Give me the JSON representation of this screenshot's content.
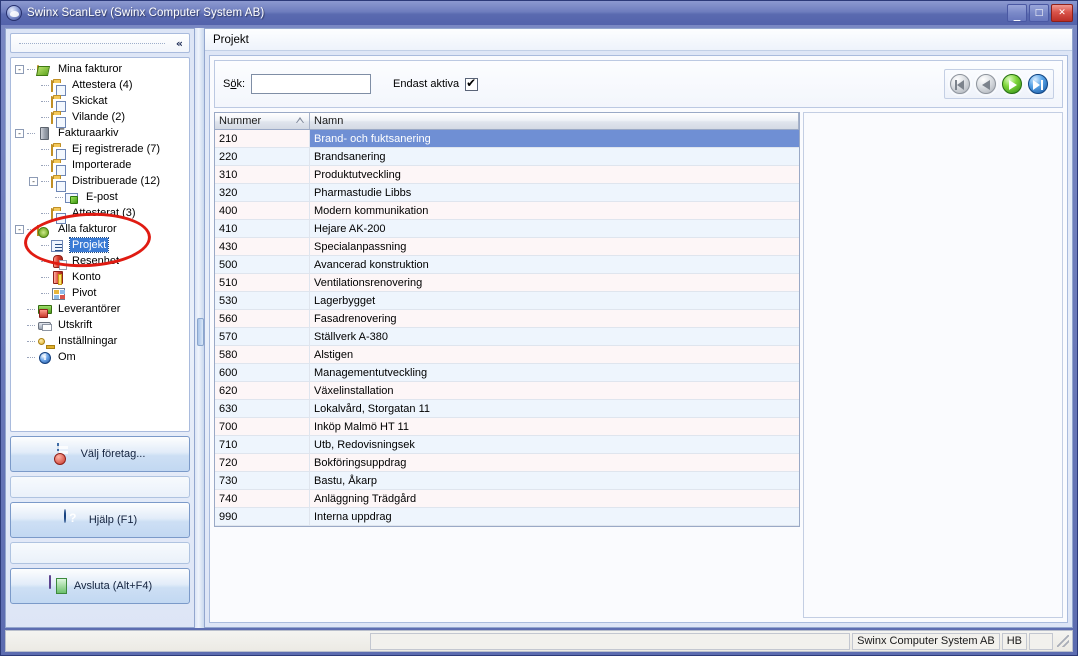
{
  "window": {
    "title": "Swinx ScanLev (Swinx Computer System AB)",
    "minimize_label": "_",
    "maximize_label": "□",
    "close_label": "✕"
  },
  "sidebar": {
    "collapse_label": "«",
    "tree": [
      {
        "label": "Mina fakturor",
        "level": 0,
        "icon": "green-folder-icon",
        "expander": "-",
        "selected": false
      },
      {
        "label": "Attestera (4)",
        "level": 1,
        "icon": "folder-doc-icon",
        "expander": "",
        "selected": false
      },
      {
        "label": "Skickat",
        "level": 1,
        "icon": "folder-doc-icon",
        "expander": "",
        "selected": false
      },
      {
        "label": "Vilande (2)",
        "level": 1,
        "icon": "folder-doc-icon",
        "expander": "",
        "selected": false
      },
      {
        "label": "Fakturaarkiv",
        "level": 0,
        "icon": "archive-icon",
        "expander": "-",
        "selected": false
      },
      {
        "label": "Ej registrerade (7)",
        "level": 1,
        "icon": "folder-doc-icon",
        "expander": "",
        "selected": false
      },
      {
        "label": "Importerade",
        "level": 1,
        "icon": "folder-doc-icon",
        "expander": "",
        "selected": false
      },
      {
        "label": "Distribuerade (12)",
        "level": 1,
        "icon": "folder-doc-icon",
        "expander": "-",
        "selected": false
      },
      {
        "label": "E-post",
        "level": 2,
        "icon": "mail-icon",
        "expander": "",
        "selected": false
      },
      {
        "label": "Attesterat (3)",
        "level": 1,
        "icon": "folder-doc-icon",
        "expander": "",
        "selected": false
      },
      {
        "label": "Alla fakturor",
        "level": 0,
        "icon": "gear-folder-icon",
        "expander": "-",
        "selected": false
      },
      {
        "label": "Projekt",
        "level": 1,
        "icon": "project-list-icon",
        "expander": "",
        "selected": true
      },
      {
        "label": "Resenhet",
        "level": 1,
        "icon": "person-icon",
        "expander": "",
        "selected": false
      },
      {
        "label": "Konto",
        "level": 1,
        "icon": "book-icon",
        "expander": "",
        "selected": false
      },
      {
        "label": "Pivot",
        "level": 1,
        "icon": "grid-icon",
        "expander": "",
        "selected": false
      },
      {
        "label": "Leverantörer",
        "level": 0,
        "icon": "truck-icon",
        "expander": "",
        "selected": false
      },
      {
        "label": "Utskrift",
        "level": 0,
        "icon": "printer-icon",
        "expander": "",
        "selected": false
      },
      {
        "label": "Inställningar",
        "level": 0,
        "icon": "key-icon",
        "expander": "",
        "selected": false
      },
      {
        "label": "Om",
        "level": 0,
        "icon": "info-icon",
        "expander": "",
        "selected": false
      }
    ],
    "buttons": {
      "company": "Välj företag...",
      "help": "Hjälp (F1)",
      "exit": "Avsluta (Alt+F4)"
    }
  },
  "page": {
    "header": "Projekt",
    "search": {
      "label_pre": "S",
      "label_accel": "ö",
      "label_post": "k:",
      "value": "",
      "placeholder": ""
    },
    "active_only": {
      "label": "Endast aktiva",
      "checked": true
    },
    "nav_buttons": [
      {
        "name": "first-record-button",
        "icon": "skip-back-icon",
        "state": "disabled"
      },
      {
        "name": "previous-record-button",
        "icon": "play-back-icon",
        "state": "disabled"
      },
      {
        "name": "next-record-button",
        "icon": "play-forward-icon",
        "state": "enabled"
      },
      {
        "name": "last-record-button",
        "icon": "skip-forward-icon",
        "state": "enabled"
      }
    ]
  },
  "grid": {
    "columns": [
      {
        "key": "nummer",
        "label": "Nummer",
        "sorted": "asc"
      },
      {
        "key": "namn",
        "label": "Namn",
        "sorted": ""
      }
    ],
    "rows": [
      {
        "nummer": "210",
        "namn": "Brand- och fuktsanering",
        "selected": true
      },
      {
        "nummer": "220",
        "namn": "Brandsanering",
        "selected": false
      },
      {
        "nummer": "310",
        "namn": "Produktutveckling",
        "selected": false
      },
      {
        "nummer": "320",
        "namn": "Pharmastudie Libbs",
        "selected": false
      },
      {
        "nummer": "400",
        "namn": "Modern kommunikation",
        "selected": false
      },
      {
        "nummer": "410",
        "namn": "Hejare AK-200",
        "selected": false
      },
      {
        "nummer": "430",
        "namn": "Specialanpassning",
        "selected": false
      },
      {
        "nummer": "500",
        "namn": "Avancerad konstruktion",
        "selected": false
      },
      {
        "nummer": "510",
        "namn": "Ventilationsrenovering",
        "selected": false
      },
      {
        "nummer": "530",
        "namn": "Lagerbygget",
        "selected": false
      },
      {
        "nummer": "560",
        "namn": "Fasadrenovering",
        "selected": false
      },
      {
        "nummer": "570",
        "namn": "Ställverk A-380",
        "selected": false
      },
      {
        "nummer": "580",
        "namn": "Alstigen",
        "selected": false
      },
      {
        "nummer": "600",
        "namn": "Managementutveckling",
        "selected": false
      },
      {
        "nummer": "620",
        "namn": "Växelinstallation",
        "selected": false
      },
      {
        "nummer": "630",
        "namn": "Lokalvård, Storgatan 11",
        "selected": false
      },
      {
        "nummer": "700",
        "namn": "Inköp Malmö HT 11",
        "selected": false
      },
      {
        "nummer": "710",
        "namn": "Utb, Redovisningsek",
        "selected": false
      },
      {
        "nummer": "720",
        "namn": "Bokföringsuppdrag",
        "selected": false
      },
      {
        "nummer": "730",
        "namn": "Bastu, Åkarp",
        "selected": false
      },
      {
        "nummer": "740",
        "namn": "Anläggning Trädgård",
        "selected": false
      },
      {
        "nummer": "990",
        "namn": "Interna uppdrag",
        "selected": false
      }
    ]
  },
  "statusbar": {
    "company": "Swinx Computer System AB",
    "user": "HB",
    "extra": ""
  },
  "colors": {
    "title_bar": "#5a6ab0",
    "selection": "#6f8fd4",
    "annotation": "#e01b12",
    "row_odd": "#fdf6f7",
    "row_even": "#eef5fd"
  }
}
